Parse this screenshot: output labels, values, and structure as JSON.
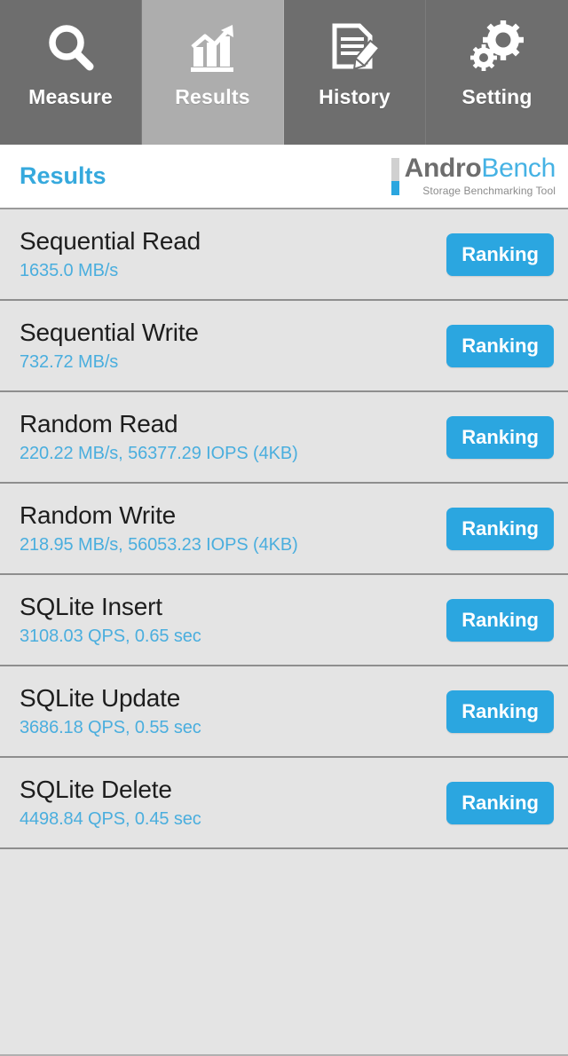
{
  "tabs": [
    {
      "label": "Measure",
      "icon": "search-icon",
      "active": false
    },
    {
      "label": "Results",
      "icon": "chart-icon",
      "active": true
    },
    {
      "label": "History",
      "icon": "document-pencil-icon",
      "active": false
    },
    {
      "label": "Setting",
      "icon": "gears-icon",
      "active": false
    }
  ],
  "header": {
    "title": "Results",
    "logo_primary": "Andro",
    "logo_secondary": "Bench",
    "logo_subtitle": "Storage Benchmarking Tool"
  },
  "results": {
    "button_label": "Ranking",
    "rows": [
      {
        "name": "Sequential Read",
        "value": "1635.0 MB/s"
      },
      {
        "name": "Sequential Write",
        "value": "732.72 MB/s"
      },
      {
        "name": "Random Read",
        "value": "220.22 MB/s, 56377.29 IOPS (4KB)"
      },
      {
        "name": "Random Write",
        "value": "218.95 MB/s, 56053.23 IOPS (4KB)"
      },
      {
        "name": "SQLite Insert",
        "value": "3108.03 QPS, 0.65 sec"
      },
      {
        "name": "SQLite Update",
        "value": "3686.18 QPS, 0.55 sec"
      },
      {
        "name": "SQLite Delete",
        "value": "4498.84 QPS, 0.45 sec"
      }
    ]
  },
  "colors": {
    "accent_blue": "#2ba6e0",
    "title_blue": "#36a9dd",
    "value_blue": "#4aaede",
    "tab_inactive": "#6e6e6e",
    "tab_active": "#adadad",
    "row_bg": "#e4e4e4"
  }
}
